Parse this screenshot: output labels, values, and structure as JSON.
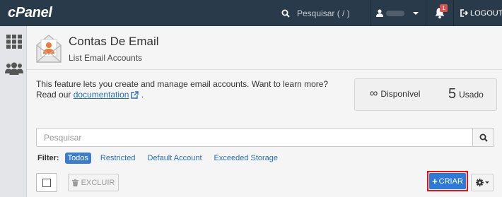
{
  "topbar": {
    "brand": "cPanel",
    "search_label": "Pesquisar ( / )",
    "notification_count": "1",
    "logout_label": "LOGOUT"
  },
  "page": {
    "title": "Contas De Email",
    "subtitle": "List Email Accounts",
    "intro_line1": "This feature lets you create and manage email accounts. Want to learn more?",
    "intro_prefix": "Read our ",
    "doc_link": "documentation",
    "intro_suffix": " ."
  },
  "stats": {
    "available_symbol": "∞",
    "available_label": "Disponível",
    "used_count": "5",
    "used_label": "Usado"
  },
  "search": {
    "placeholder": "Pesquisar"
  },
  "filter": {
    "label": "Filter:",
    "options": [
      "Todos",
      "Restricted",
      "Default Account",
      "Exceeded Storage"
    ],
    "active": "Todos"
  },
  "actions": {
    "delete_label": "EXCLUIR",
    "create_label": "CRIAR"
  },
  "colors": {
    "topbar": "#293a4a",
    "primary": "#2f7ad6",
    "highlight": "#e21414",
    "link": "#2a6ebb"
  }
}
